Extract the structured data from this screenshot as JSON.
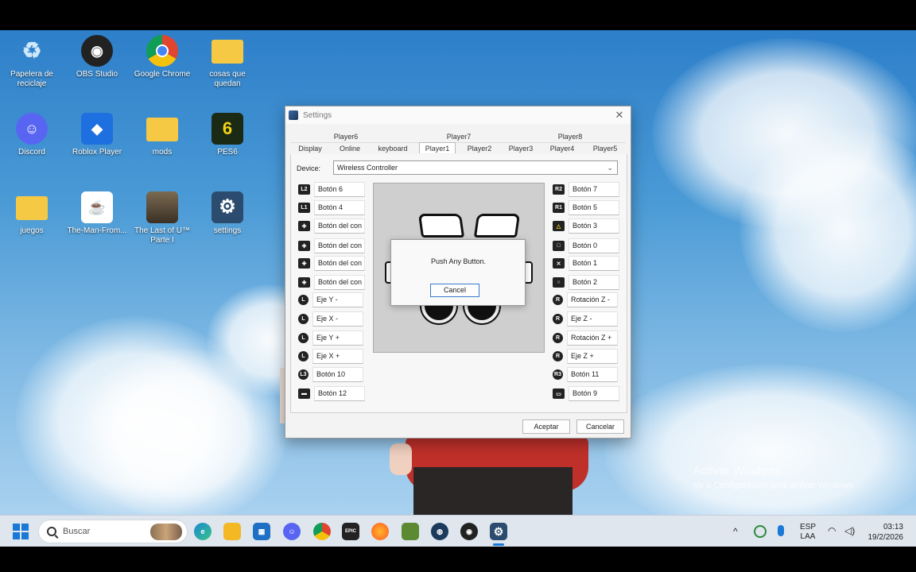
{
  "desktop_icons": [
    {
      "label": "Papelera de reciclaje",
      "icon": "recycle-bin-icon",
      "color": "#4aa3e0"
    },
    {
      "label": "OBS Studio",
      "icon": "obs-icon",
      "color": "#222222"
    },
    {
      "label": "Google Chrome",
      "icon": "chrome-icon",
      "color": "#e0452f"
    },
    {
      "label": "cosas que quedan",
      "icon": "folder-icon",
      "color": "#f4c542"
    },
    {
      "label": "Discord",
      "icon": "discord-icon",
      "color": "#5865f2"
    },
    {
      "label": "Roblox Player",
      "icon": "roblox-icon",
      "color": "#1e6fe0"
    },
    {
      "label": "mods",
      "icon": "folder-icon",
      "color": "#f4c542"
    },
    {
      "label": "PES6",
      "icon": "pes6-icon",
      "color": "#1b2a14"
    },
    {
      "label": "juegos",
      "icon": "folder-icon",
      "color": "#f4c542"
    },
    {
      "label": "The-Man-From...",
      "icon": "java-icon",
      "color": "#ffffff"
    },
    {
      "label": "The Last of U™ Parte I",
      "icon": "tlou-icon",
      "color": "#5a4a3a"
    },
    {
      "label": "settings",
      "icon": "settings-app-icon",
      "color": "#2b4c6e"
    }
  ],
  "icon_glyphs": {
    "obs": "◉",
    "chrome": "◎",
    "discord": "☺",
    "roblox": "◆",
    "pes6": "6",
    "java": "☕",
    "settings": "⚙",
    "recycle": "♻"
  },
  "window": {
    "title": "Settings",
    "close_glyph": "✕",
    "tabs_row1": [
      "Player6",
      "Player7",
      "Player8"
    ],
    "tabs_row2": [
      "Display",
      "Online",
      "keyboard",
      "Player1",
      "Player2",
      "Player3",
      "Player4",
      "Player5"
    ],
    "active_tab": "Player1",
    "device_label": "Device:",
    "device_value": "Wireless Controller",
    "left_mappings": [
      {
        "icon": "L2",
        "label": "Botón 6"
      },
      {
        "icon": "L1",
        "label": "Botón 4"
      },
      {
        "icon": "✚",
        "label": "Botón del con"
      },
      {
        "icon": "✚",
        "label": "Botón del con"
      },
      {
        "icon": "✚",
        "label": "Botón del con"
      },
      {
        "icon": "✚",
        "label": "Botón del con"
      },
      {
        "icon": "L",
        "label": "Eje Y -"
      },
      {
        "icon": "L",
        "label": "Eje X -"
      },
      {
        "icon": "L",
        "label": "Eje Y +"
      },
      {
        "icon": "L",
        "label": "Eje X +"
      },
      {
        "icon": "L3",
        "label": "Botón 10"
      },
      {
        "icon": "▬",
        "label": "Botón 12"
      }
    ],
    "right_mappings": [
      {
        "icon": "R2",
        "label": "Botón 7"
      },
      {
        "icon": "R1",
        "label": "Botón 5"
      },
      {
        "icon": "△",
        "label": "Botón 3"
      },
      {
        "icon": "□",
        "label": "Botón 0"
      },
      {
        "icon": "✕",
        "label": "Botón 1"
      },
      {
        "icon": "○",
        "label": "Botón 2"
      },
      {
        "icon": "R",
        "label": "Rotación Z -"
      },
      {
        "icon": "R",
        "label": "Eje Z -"
      },
      {
        "icon": "R",
        "label": "Rotación Z +"
      },
      {
        "icon": "R",
        "label": "Eje Z +"
      },
      {
        "icon": "R3",
        "label": "Botón 11"
      },
      {
        "icon": "▭",
        "label": "Botón 9"
      }
    ],
    "dialog": {
      "message": "Push Any Button.",
      "cancel": "Cancel"
    },
    "ok_label": "Aceptar",
    "cancel_label": "Cancelar"
  },
  "watermark": {
    "line1": "Activar Windows",
    "line2": "Ve a Configuración para activar Windows."
  },
  "taskbar": {
    "search_placeholder": "Buscar",
    "pinned": [
      {
        "name": "edge",
        "color": "#1e88d0",
        "glyph": "e"
      },
      {
        "name": "file-explorer",
        "color": "#f3b823",
        "glyph": "▰"
      },
      {
        "name": "store",
        "color": "#1f6fc4",
        "glyph": "▦"
      },
      {
        "name": "discord",
        "color": "#5865f2",
        "glyph": "☺"
      },
      {
        "name": "chrome",
        "color": "#e0452f",
        "glyph": "◎"
      },
      {
        "name": "epic-games",
        "color": "#222222",
        "glyph": "EPIC"
      },
      {
        "name": "firefox",
        "color": "#ff6a1f",
        "glyph": "◐"
      },
      {
        "name": "minecraft",
        "color": "#5b8a32",
        "glyph": "▣"
      },
      {
        "name": "steam",
        "color": "#1b3a5c",
        "glyph": "◍"
      },
      {
        "name": "obs",
        "color": "#222222",
        "glyph": "◉"
      },
      {
        "name": "settings-app",
        "color": "#2b4c6e",
        "glyph": "⚙"
      }
    ],
    "tray": {
      "chevron": "^",
      "lang_line1": "ESP",
      "lang_line2": "LAA",
      "time": "03:13",
      "date": "19/2/2026"
    }
  }
}
